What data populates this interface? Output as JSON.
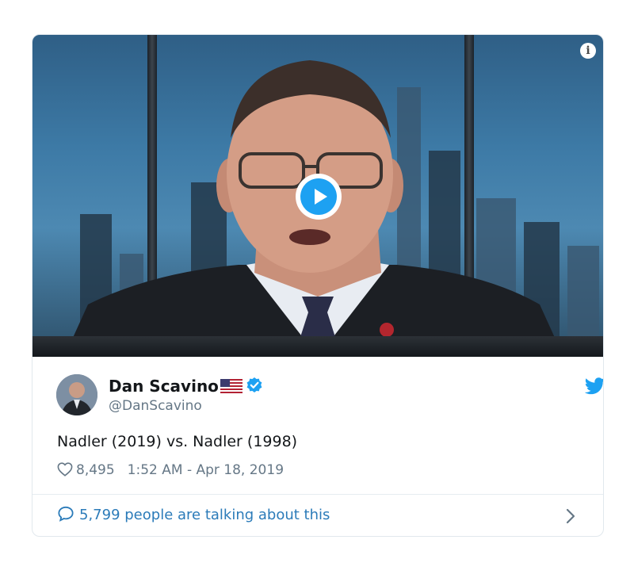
{
  "tweet": {
    "author": {
      "display_name": "Dan Scavino",
      "handle": "@DanScavino",
      "verified": true,
      "flag_icon": "us-flag-icon"
    },
    "text": "Nadler (2019) vs. Nadler (1998)",
    "likes": "8,495",
    "timestamp": "1:52 AM - Apr 18, 2019",
    "discussion": "5,799 people are talking about this"
  },
  "icons": {
    "info": "info-icon",
    "play": "play-icon",
    "verified": "verified-badge-icon",
    "twitter": "twitter-bird-icon",
    "like": "heart-icon",
    "reply": "speech-bubble-icon",
    "chevron": "chevron-right-icon"
  },
  "colors": {
    "accent": "#1da1f2",
    "link": "#2b7bb9",
    "muted": "#657786",
    "text": "#14171a",
    "border": "#e1e8ed"
  }
}
